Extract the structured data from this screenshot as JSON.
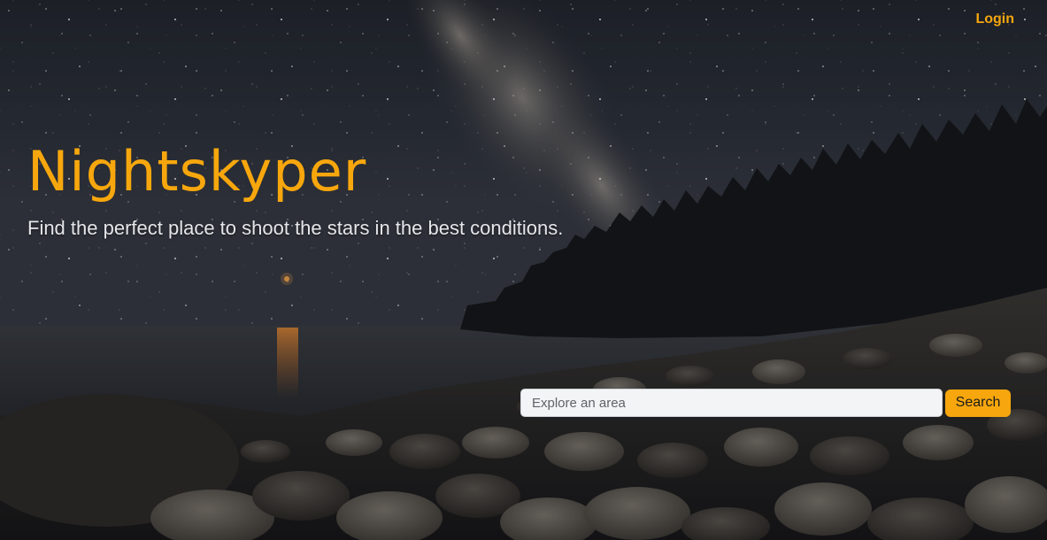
{
  "nav": {
    "login_label": "Login"
  },
  "hero": {
    "title": "Nightskyper",
    "subtitle": "Find the perfect place to shoot the stars in the best conditions."
  },
  "search": {
    "placeholder": "Explore an area",
    "value": "",
    "button_label": "Search"
  },
  "colors": {
    "accent": "#f7a70d",
    "sky": "#2a2f3a",
    "input_bg": "#f3f4f6"
  },
  "icons": {
    "background_image": "night-sky-milky-way-rocky-shore-photo"
  }
}
